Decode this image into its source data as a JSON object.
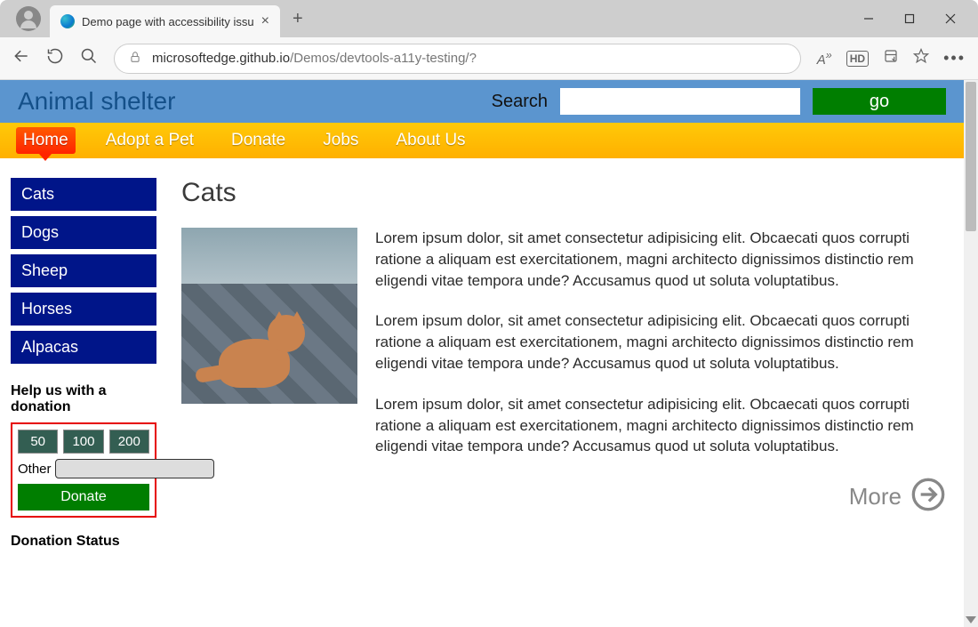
{
  "browser": {
    "tab_title": "Demo page with accessibility issu",
    "url_host": "microsoftedge.github.io",
    "url_path": "/Demos/devtools-a11y-testing/?",
    "read_aloud_label": "A",
    "hd_badge": "HD"
  },
  "site": {
    "title": "Animal shelter",
    "search_label": "Search",
    "go_label": "go"
  },
  "nav": {
    "items": [
      "Home",
      "Adopt a Pet",
      "Donate",
      "Jobs",
      "About Us"
    ],
    "active_index": 0
  },
  "sidebar": {
    "links": [
      "Cats",
      "Dogs",
      "Sheep",
      "Horses",
      "Alpacas"
    ],
    "donation_heading": "Help us with a donation",
    "amounts": [
      "50",
      "100",
      "200"
    ],
    "other_label": "Other",
    "donate_label": "Donate",
    "status_heading": "Donation Status"
  },
  "main": {
    "heading": "Cats",
    "paragraphs": [
      "Lorem ipsum dolor, sit amet consectetur adipisicing elit. Obcaecati quos corrupti ratione a aliquam est exercitationem, magni architecto dignissimos distinctio rem eligendi vitae tempora unde? Accusamus quod ut soluta voluptatibus.",
      "Lorem ipsum dolor, sit amet consectetur adipisicing elit. Obcaecati quos corrupti ratione a aliquam est exercitationem, magni architecto dignissimos distinctio rem eligendi vitae tempora unde? Accusamus quod ut soluta voluptatibus.",
      "Lorem ipsum dolor, sit amet consectetur adipisicing elit. Obcaecati quos corrupti ratione a aliquam est exercitationem, magni architecto dignissimos distinctio rem eligendi vitae tempora unde? Accusamus quod ut soluta voluptatibus."
    ],
    "more_label": "More"
  }
}
